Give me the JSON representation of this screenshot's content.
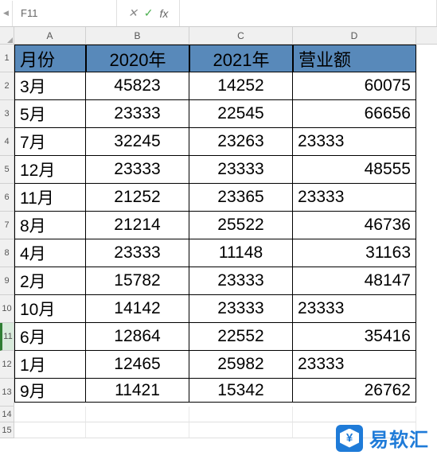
{
  "namebox": "F11",
  "fx_cancel": "✕",
  "fx_accept": "✓",
  "fx_label": "fx",
  "columns": [
    "A",
    "B",
    "C",
    "D"
  ],
  "headers": {
    "A": "月份",
    "B": "2020年",
    "C": "2021年",
    "D": "营业额"
  },
  "rows": [
    {
      "n": "2",
      "A": "3月",
      "B": "45823",
      "C": "14252",
      "D": "60075",
      "dl": false
    },
    {
      "n": "3",
      "A": "5月",
      "B": "23333",
      "C": "22545",
      "D": "66656",
      "dl": false
    },
    {
      "n": "4",
      "A": "7月",
      "B": "32245",
      "C": "23263",
      "D": "23333",
      "dl": true
    },
    {
      "n": "5",
      "A": "12月",
      "B": "23333",
      "C": "23333",
      "D": "48555",
      "dl": false
    },
    {
      "n": "6",
      "A": "11月",
      "B": "21252",
      "C": "23365",
      "D": "23333",
      "dl": true
    },
    {
      "n": "7",
      "A": "8月",
      "B": "21214",
      "C": "25522",
      "D": "46736",
      "dl": false
    },
    {
      "n": "8",
      "A": "4月",
      "B": "23333",
      "C": "11148",
      "D": "31163",
      "dl": false
    },
    {
      "n": "9",
      "A": "2月",
      "B": "15782",
      "C": "23333",
      "D": "48147",
      "dl": false
    },
    {
      "n": "10",
      "A": "10月",
      "B": "14142",
      "C": "23333",
      "D": "23333",
      "dl": true
    },
    {
      "n": "11",
      "A": "6月",
      "B": "12864",
      "C": "22552",
      "D": "35416",
      "dl": false,
      "active": true
    },
    {
      "n": "12",
      "A": "1月",
      "B": "12465",
      "C": "25982",
      "D": "23333",
      "dl": true
    },
    {
      "n": "13",
      "A": "9月",
      "B": "11421",
      "C": "15342",
      "D": "26762",
      "dl": false,
      "last": true
    }
  ],
  "empty_rows": [
    "14",
    "15"
  ],
  "watermark": {
    "text": "易软汇",
    "icon": "¥"
  }
}
